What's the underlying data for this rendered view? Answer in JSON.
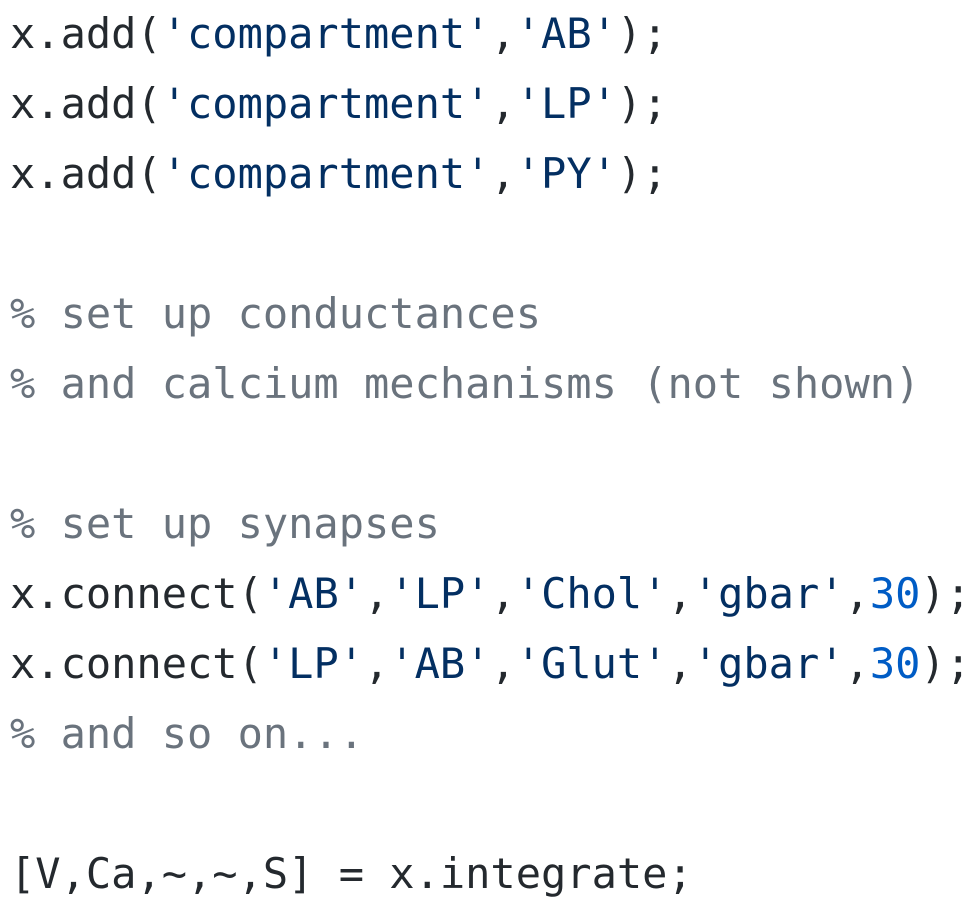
{
  "code": {
    "lines": [
      [
        {
          "t": "plain",
          "v": "x.add("
        },
        {
          "t": "string",
          "v": "'compartment'"
        },
        {
          "t": "plain",
          "v": ","
        },
        {
          "t": "string",
          "v": "'AB'"
        },
        {
          "t": "plain",
          "v": ");"
        }
      ],
      [
        {
          "t": "plain",
          "v": "x.add("
        },
        {
          "t": "string",
          "v": "'compartment'"
        },
        {
          "t": "plain",
          "v": ","
        },
        {
          "t": "string",
          "v": "'LP'"
        },
        {
          "t": "plain",
          "v": ");"
        }
      ],
      [
        {
          "t": "plain",
          "v": "x.add("
        },
        {
          "t": "string",
          "v": "'compartment'"
        },
        {
          "t": "plain",
          "v": ","
        },
        {
          "t": "string",
          "v": "'PY'"
        },
        {
          "t": "plain",
          "v": ");"
        }
      ],
      [],
      [
        {
          "t": "comment",
          "v": "% set up conductances"
        }
      ],
      [
        {
          "t": "comment",
          "v": "% and calcium mechanisms (not shown)"
        }
      ],
      [],
      [
        {
          "t": "comment",
          "v": "% set up synapses"
        }
      ],
      [
        {
          "t": "plain",
          "v": "x.connect("
        },
        {
          "t": "string",
          "v": "'AB'"
        },
        {
          "t": "plain",
          "v": ","
        },
        {
          "t": "string",
          "v": "'LP'"
        },
        {
          "t": "plain",
          "v": ","
        },
        {
          "t": "string",
          "v": "'Chol'"
        },
        {
          "t": "plain",
          "v": ","
        },
        {
          "t": "string",
          "v": "'gbar'"
        },
        {
          "t": "plain",
          "v": ","
        },
        {
          "t": "number",
          "v": "30"
        },
        {
          "t": "plain",
          "v": ");"
        }
      ],
      [
        {
          "t": "plain",
          "v": "x.connect("
        },
        {
          "t": "string",
          "v": "'LP'"
        },
        {
          "t": "plain",
          "v": ","
        },
        {
          "t": "string",
          "v": "'AB'"
        },
        {
          "t": "plain",
          "v": ","
        },
        {
          "t": "string",
          "v": "'Glut'"
        },
        {
          "t": "plain",
          "v": ","
        },
        {
          "t": "string",
          "v": "'gbar'"
        },
        {
          "t": "plain",
          "v": ","
        },
        {
          "t": "number",
          "v": "30"
        },
        {
          "t": "plain",
          "v": ");"
        }
      ],
      [
        {
          "t": "comment",
          "v": "% and so on..."
        }
      ],
      [],
      [
        {
          "t": "plain",
          "v": "[V,Ca,~,~,S] = x.integrate;"
        }
      ]
    ]
  },
  "colors": {
    "plain": "#24292e",
    "string": "#032f62",
    "number": "#005cc5",
    "comment": "#6a737d",
    "background": "#ffffff"
  }
}
